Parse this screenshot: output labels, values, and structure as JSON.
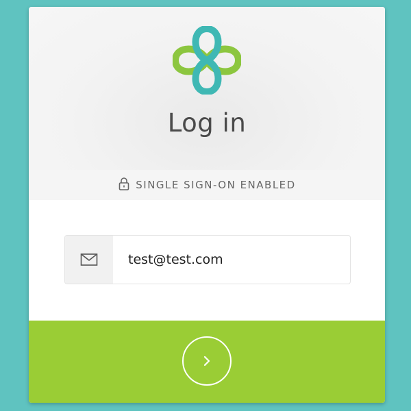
{
  "login": {
    "title": "Log in",
    "sso_label": "SINGLE SIGN-ON ENABLED",
    "email": {
      "value": "test@test.com",
      "icon": "envelope-icon"
    },
    "submit": {
      "icon": "chevron-right-icon"
    }
  },
  "icons": {
    "logo": "clover-logo",
    "lock": "lock-icon"
  },
  "colors": {
    "background": "#5fc3c0",
    "accent_green": "#9acd35",
    "logo_teal": "#3fb8b4",
    "logo_green": "#8cc63f",
    "title_text": "#4a4a4a"
  }
}
